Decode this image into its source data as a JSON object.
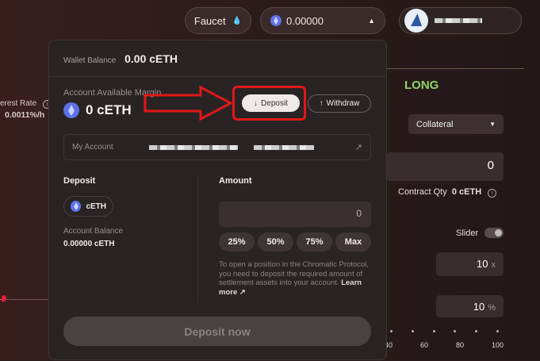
{
  "header": {
    "faucet_label": "Faucet",
    "balance_value": "0.00000"
  },
  "side": {
    "rate_label": "erest Rate",
    "rate_value": "0.0011%/h"
  },
  "modal": {
    "wallet_balance_label": "Wallet Balance",
    "wallet_balance_value": "0.00 cETH",
    "available_margin_label": "Account Available Margin",
    "available_margin_value": "0 cETH",
    "deposit_button": "Deposit",
    "withdraw_button": "Withdraw",
    "my_account_label": "My Account",
    "deposit_section": "Deposit",
    "token": "cETH",
    "account_balance_label": "Account Balance",
    "account_balance_value": "0.00000 cETH",
    "amount_section": "Amount",
    "amount_value": "0",
    "pct_buttons": [
      "25%",
      "50%",
      "75%",
      "Max"
    ],
    "helper_text": "To open a position in the Chromatic Protocol, you need to deposit the required amount of settlement assets into your account.",
    "learn_more": "Learn more",
    "deposit_now_button": "Deposit now"
  },
  "trade": {
    "side_title": "LONG",
    "collateral_label": "Collateral",
    "collateral_value": "0",
    "contract_qty_label": "Contract Qty",
    "contract_qty_value": "0 cETH",
    "slider_label": "Slider",
    "leverage_value": "10",
    "leverage_unit": "x",
    "percent_value": "10",
    "percent_unit": "%",
    "ticks": [
      "40",
      "60",
      "80",
      "100"
    ]
  },
  "colors": {
    "highlight": "#e01818",
    "long": "#8fd46a",
    "eth": "#5b72e6"
  }
}
